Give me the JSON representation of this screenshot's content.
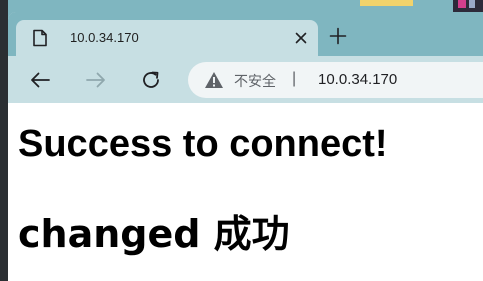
{
  "tab": {
    "title": "10.0.34.170",
    "icons": {
      "page": "document-icon",
      "close": "close-icon",
      "new_tab": "plus-icon"
    }
  },
  "toolbar": {
    "icons": {
      "back": "back-arrow-icon",
      "forward": "forward-arrow-icon",
      "reload": "reload-icon"
    }
  },
  "omnibox": {
    "security_label": "不安全",
    "separator": "|",
    "url": "10.0.34.170",
    "icons": {
      "security": "warning-icon"
    }
  },
  "page": {
    "heading": "Success to connect!",
    "subheading": "changed 成功"
  },
  "colors": {
    "tabstrip": "#7fb6c0",
    "toolbar": "#c7dfe3",
    "omnibox": "#f1f5f6",
    "page_bg": "#ffffff"
  }
}
